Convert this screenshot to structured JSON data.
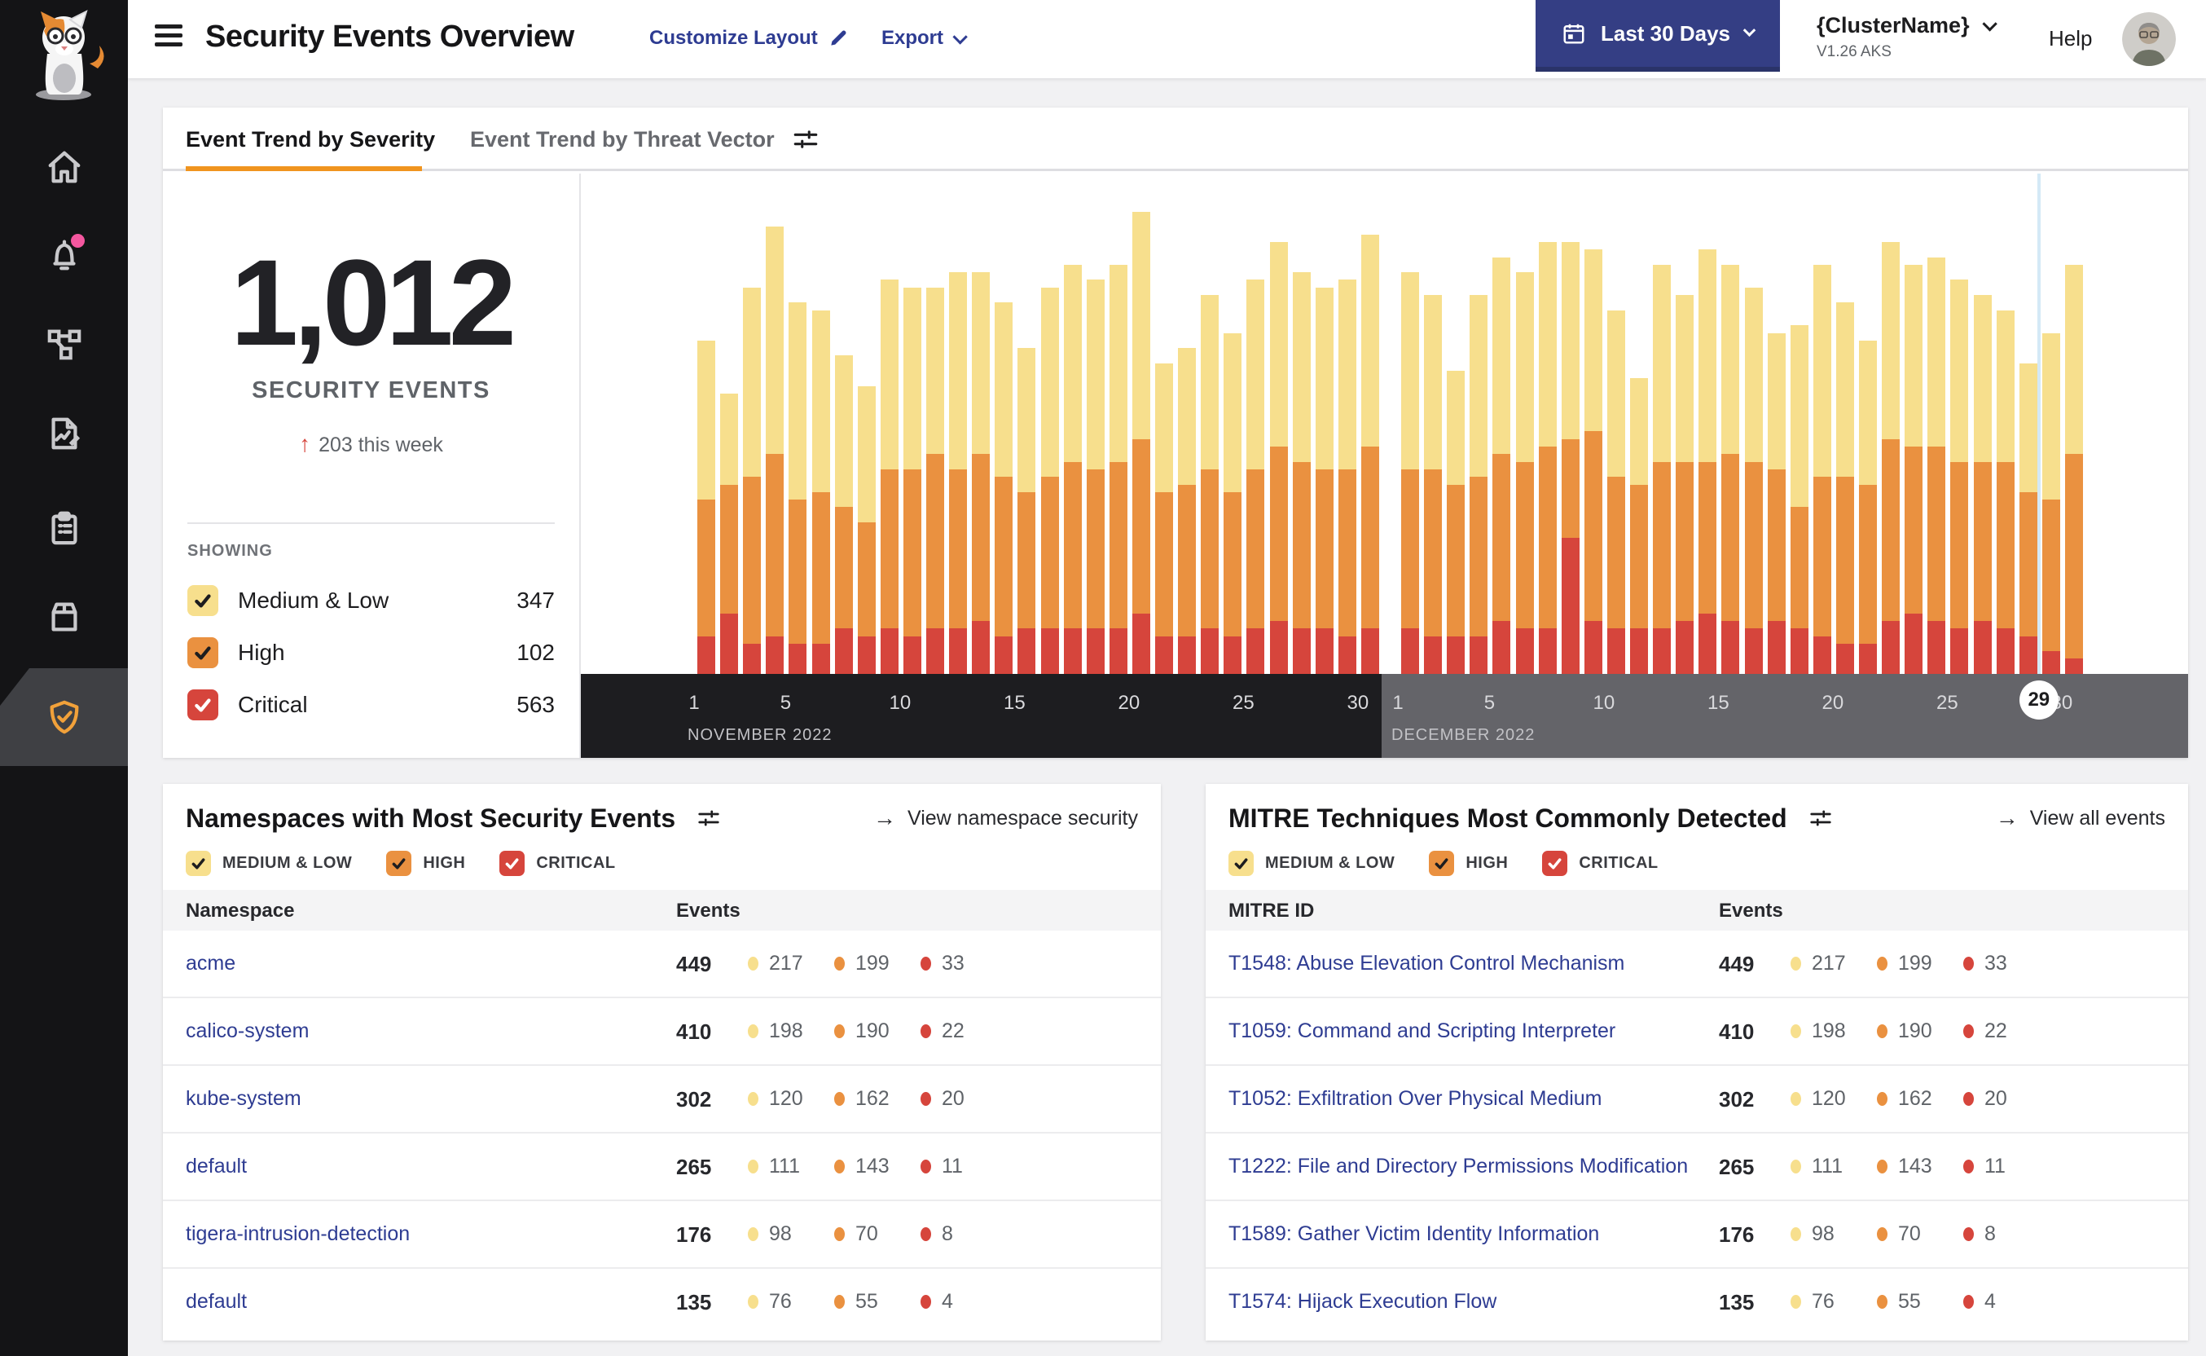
{
  "app": {
    "title": "Security Events Overview",
    "customize_layout": "Customize Layout",
    "export_label": "Export",
    "date_range": "Last 30 Days",
    "cluster_name": "{ClusterName}",
    "cluster_version": "V1.26 AKS",
    "help": "Help"
  },
  "sidebar": {
    "items": [
      "home",
      "alerts",
      "service-graph",
      "policies",
      "compliance",
      "workloads",
      "threat-defense"
    ],
    "active_item": "threat-defense",
    "notification_dot": true
  },
  "tabs": {
    "severity": "Event Trend by Severity",
    "threat_vector": "Event Trend by Threat Vector"
  },
  "summary": {
    "total": "1,012",
    "label": "SECURITY EVENTS",
    "delta_arrow": "↑",
    "delta": "203 this week",
    "showing_label": "SHOWING"
  },
  "severities": [
    {
      "key": "medium_low",
      "label": "Medium & Low",
      "filter_label": "MEDIUM & LOW",
      "count": "347",
      "color": "#F7DF8D",
      "check": "#1d1d1f"
    },
    {
      "key": "high",
      "label": "High",
      "filter_label": "HIGH",
      "count": "102",
      "color": "#EA9140",
      "check": "#1d1d1f"
    },
    {
      "key": "critical",
      "label": "Critical",
      "filter_label": "CRITICAL",
      "count": "563",
      "color": "#D6453C",
      "check": "#ffffff"
    }
  ],
  "chart_data": {
    "type": "bar",
    "stacked": true,
    "stack_order": [
      "critical",
      "high",
      "medium_low"
    ],
    "x_ticks": [
      1,
      5,
      10,
      15,
      20,
      25,
      30
    ],
    "months": [
      {
        "label": "NOVEMBER 2022",
        "short": "nov",
        "days": 30
      },
      {
        "label": "DECEMBER 2022",
        "short": "dec",
        "days": 30
      }
    ],
    "today": {
      "month_index": 1,
      "day": 29
    },
    "y_axis": {
      "labels_visible": false,
      "unit": "events per day (estimated from bar heights)"
    },
    "series": [
      {
        "name": "Medium & Low",
        "key": "medium_low",
        "color": "#F7DF8D",
        "values": [
          21,
          12,
          25,
          30,
          26,
          24,
          20,
          18,
          25,
          24,
          22,
          26,
          24,
          23,
          19,
          25,
          26,
          25,
          26,
          30,
          17,
          18,
          23,
          21,
          25,
          27,
          25,
          24,
          25,
          28,
          26,
          23,
          15,
          24,
          26,
          25,
          27,
          26,
          24,
          22,
          14,
          26,
          22,
          28,
          25,
          23,
          18,
          24,
          28,
          23,
          19,
          26,
          24,
          25,
          24,
          22,
          20,
          17,
          22,
          25
        ]
      },
      {
        "name": "High",
        "key": "high",
        "color": "#EA9140",
        "values": [
          18,
          17,
          22,
          24,
          19,
          20,
          16,
          15,
          21,
          22,
          23,
          21,
          22,
          21,
          18,
          20,
          22,
          21,
          22,
          23,
          19,
          20,
          21,
          19,
          21,
          23,
          22,
          21,
          22,
          24,
          21,
          22,
          20,
          21,
          22,
          22,
          24,
          13,
          25,
          20,
          19,
          22,
          21,
          20,
          22,
          22,
          20,
          16,
          21,
          22,
          21,
          24,
          22,
          23,
          22,
          21,
          22,
          19,
          20,
          27
        ]
      },
      {
        "name": "Critical",
        "key": "critical",
        "color": "#D6453C",
        "values": [
          5,
          8,
          4,
          5,
          4,
          4,
          6,
          5,
          6,
          5,
          6,
          6,
          7,
          5,
          6,
          6,
          6,
          6,
          6,
          8,
          5,
          5,
          6,
          5,
          6,
          7,
          6,
          6,
          5,
          6,
          6,
          5,
          5,
          5,
          7,
          6,
          6,
          18,
          7,
          6,
          6,
          6,
          7,
          8,
          7,
          6,
          7,
          6,
          5,
          4,
          4,
          7,
          8,
          7,
          6,
          7,
          6,
          5,
          3,
          2
        ]
      }
    ]
  },
  "panels": [
    {
      "title": "Namespaces with Most Security Events",
      "link": "View namespace security",
      "link_arrow": "→",
      "columns": [
        "Namespace",
        "Events"
      ],
      "rows": [
        {
          "name": "acme",
          "total": "449",
          "counts": [
            "217",
            "199",
            "33"
          ]
        },
        {
          "name": "calico-system",
          "total": "410",
          "counts": [
            "198",
            "190",
            "22"
          ]
        },
        {
          "name": "kube-system",
          "total": "302",
          "counts": [
            "120",
            "162",
            "20"
          ]
        },
        {
          "name": "default",
          "total": "265",
          "counts": [
            "111",
            "143",
            "11"
          ]
        },
        {
          "name": "tigera-intrusion-detection",
          "total": "176",
          "counts": [
            "98",
            "70",
            "8"
          ]
        },
        {
          "name": "default",
          "total": "135",
          "counts": [
            "76",
            "55",
            "4"
          ]
        }
      ]
    },
    {
      "title": "MITRE Techniques Most Commonly Detected",
      "link": "View all events",
      "link_arrow": "→",
      "columns": [
        "MITRE ID",
        "Events"
      ],
      "rows": [
        {
          "name": "T1548: Abuse Elevation Control Mechanism",
          "total": "449",
          "counts": [
            "217",
            "199",
            "33"
          ]
        },
        {
          "name": "T1059: Command and Scripting Interpreter",
          "total": "410",
          "counts": [
            "198",
            "190",
            "22"
          ]
        },
        {
          "name": "T1052: Exfiltration Over Physical Medium",
          "total": "302",
          "counts": [
            "120",
            "162",
            "20"
          ]
        },
        {
          "name": "T1222: File and Directory Permissions Modification",
          "total": "265",
          "counts": [
            "111",
            "143",
            "11"
          ]
        },
        {
          "name": "T1589: Gather Victim Identity Information",
          "total": "176",
          "counts": [
            "98",
            "70",
            "8"
          ]
        },
        {
          "name": "T1574: Hijack Execution Flow",
          "total": "135",
          "counts": [
            "76",
            "55",
            "4"
          ]
        }
      ]
    }
  ],
  "colors": {
    "accent_orange": "#F0941F",
    "navy_link": "#2e3c92",
    "navy_button": "#343E84",
    "band_november": "#1d1d20",
    "band_december": "#646469",
    "today_line_blue": "#d4e9f6",
    "delta_red": "#D6453C",
    "notification_pink": "#f4579f"
  }
}
